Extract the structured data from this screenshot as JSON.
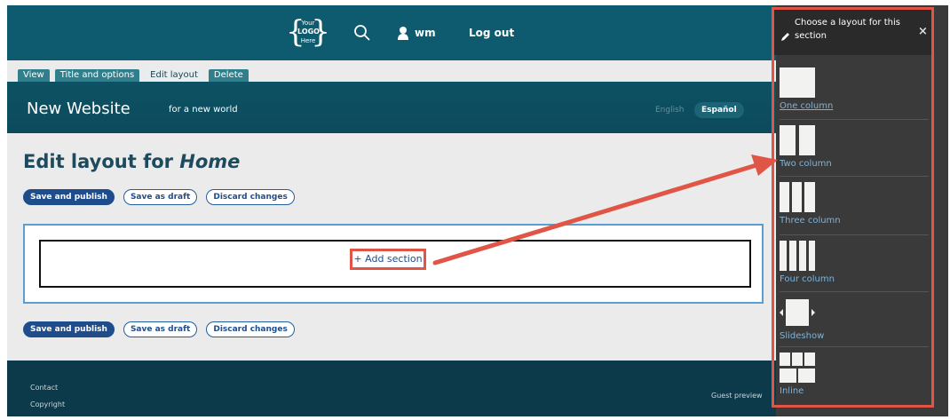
{
  "admin_bar": {
    "logo": {
      "line1": "Your",
      "line2": "LOGO",
      "line3": "Here"
    },
    "user": "wm",
    "logout": "Log out"
  },
  "tabs": [
    {
      "label": "View"
    },
    {
      "label": "Title and options"
    },
    {
      "label": "Edit layout"
    },
    {
      "label": "Delete"
    }
  ],
  "site": {
    "name": "New Website",
    "slogan": "for a new world",
    "languages": {
      "en": "English",
      "es": "Español"
    }
  },
  "main": {
    "title_prefix": "Edit layout for",
    "title_page": "Home",
    "buttons": {
      "save_publish": "Save and publish",
      "save_draft": "Save as draft",
      "discard": "Discard changes"
    },
    "add_section": "Add section"
  },
  "footer": {
    "contact": "Contact",
    "copyright": "Copyright",
    "guest_preview": "Guest preview"
  },
  "panel": {
    "title": "Choose a layout for this section",
    "close": "×",
    "options": [
      {
        "label": "One column"
      },
      {
        "label": "Two column"
      },
      {
        "label": "Three column"
      },
      {
        "label": "Four column"
      },
      {
        "label": "Slideshow"
      },
      {
        "label": "Inline"
      }
    ]
  },
  "colors": {
    "accent": "#e05545",
    "brand": "#0e5a6e",
    "panel": "#3a3a3a",
    "link": "#7fb3d5"
  }
}
